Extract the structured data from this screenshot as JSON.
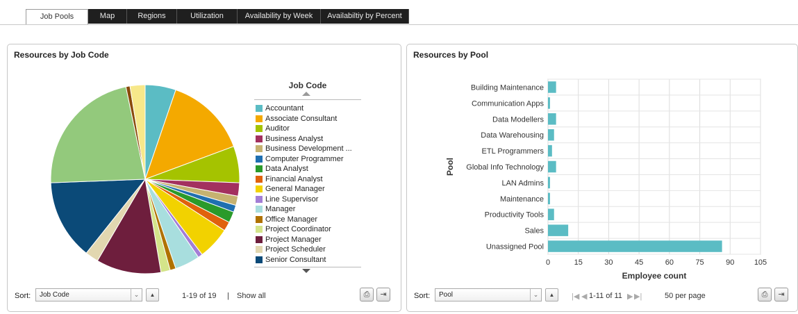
{
  "tabs": [
    {
      "label": "Job Pools",
      "active": true
    },
    {
      "label": "Map",
      "active": false
    },
    {
      "label": "Regions",
      "active": false
    },
    {
      "label": "Utilization",
      "active": false
    },
    {
      "label": "Availability by Week",
      "active": false
    },
    {
      "label": "Availabiltiy by Percent",
      "active": false
    }
  ],
  "left_panel": {
    "title": "Resources by Job Code",
    "legend_header": "Job Code",
    "legend": [
      {
        "label": "Accountant",
        "color": "#5bbcc4"
      },
      {
        "label": "Associate Consultant",
        "color": "#f4a900"
      },
      {
        "label": "Auditor",
        "color": "#a5c300"
      },
      {
        "label": "Business Analyst",
        "color": "#a3305f"
      },
      {
        "label": "Business Development ...",
        "color": "#c6b270"
      },
      {
        "label": "Computer Programmer",
        "color": "#1f6fb0"
      },
      {
        "label": "Data Analyst",
        "color": "#2a9a2a"
      },
      {
        "label": "Financial Analyst",
        "color": "#e0620c"
      },
      {
        "label": "General Manager",
        "color": "#f2d200"
      },
      {
        "label": "Line Supervisor",
        "color": "#a37ed6"
      },
      {
        "label": "Manager",
        "color": "#a8dede"
      },
      {
        "label": "Office Manager",
        "color": "#b07200"
      },
      {
        "label": "Project Coordinator",
        "color": "#d4e48a"
      },
      {
        "label": "Project Manager",
        "color": "#6e1e3d"
      },
      {
        "label": "Project Scheduler",
        "color": "#e2d7b0"
      },
      {
        "label": "Senior Consultant",
        "color": "#0b4a78"
      }
    ],
    "pie": {
      "slices": [
        {
          "name": "Accountant",
          "value": 5.3,
          "color": "#5bbcc4"
        },
        {
          "name": "Associate Consultant",
          "value": 14.2,
          "color": "#f4a900"
        },
        {
          "name": "Auditor",
          "value": 6.3,
          "color": "#a5c300"
        },
        {
          "name": "Business Analyst",
          "value": 2.3,
          "color": "#a3305f"
        },
        {
          "name": "Business Development ...",
          "value": 1.6,
          "color": "#c6b270"
        },
        {
          "name": "Computer Programmer",
          "value": 1.2,
          "color": "#1f6fb0"
        },
        {
          "name": "Data Analyst",
          "value": 1.9,
          "color": "#2a9a2a"
        },
        {
          "name": "Financial Analyst",
          "value": 1.6,
          "color": "#e0620c"
        },
        {
          "name": "General Manager",
          "value": 5.6,
          "color": "#f2d200"
        },
        {
          "name": "Line Supervisor",
          "value": 0.8,
          "color": "#a37ed6"
        },
        {
          "name": "Manager",
          "value": 4.3,
          "color": "#a8dede"
        },
        {
          "name": "Office Manager",
          "value": 1.0,
          "color": "#b07200"
        },
        {
          "name": "Project Coordinator",
          "value": 1.6,
          "color": "#d4e48a"
        },
        {
          "name": "Project Manager",
          "value": 11.2,
          "color": "#6e1e3d"
        },
        {
          "name": "Project Scheduler",
          "value": 2.3,
          "color": "#e2d7b0"
        },
        {
          "name": "Senior Consultant",
          "value": 13.8,
          "color": "#0b4a78"
        },
        {
          "name": "(unlisted)",
          "value": 22.5,
          "color": "#93c97c"
        },
        {
          "name": "(unlisted)",
          "value": 0.7,
          "color": "#8a4a0a"
        },
        {
          "name": "(unlisted)",
          "value": 2.6,
          "color": "#f7e88a"
        }
      ]
    },
    "footer": {
      "sort_label": "Sort:",
      "sort_value": "Job Code",
      "range": "1-19 of 19",
      "separator": "|",
      "show_all": "Show all"
    }
  },
  "right_panel": {
    "title": "Resources by Pool",
    "footer": {
      "sort_label": "Sort:",
      "sort_value": "Pool",
      "range": "1-11 of 11",
      "per_page": "50 per page"
    }
  },
  "chart_data": {
    "type": "bar",
    "orientation": "horizontal",
    "title": "Resources by Pool",
    "xlabel": "Employee count",
    "ylabel": "Pool",
    "categories": [
      "Building Maintenance",
      "Communication Apps",
      "Data Modellers",
      "Data Warehousing",
      "ETL Programmers",
      "Global Info Technology",
      "LAN Admins",
      "Maintenance",
      "Productivity Tools",
      "Sales",
      "Unassigned Pool"
    ],
    "values": [
      4,
      1,
      4,
      3,
      2,
      4,
      1,
      1,
      3,
      10,
      86
    ],
    "xlim": [
      0,
      105
    ],
    "xticks": [
      0,
      15,
      30,
      45,
      60,
      75,
      90,
      105
    ],
    "color": "#5bbcc4",
    "grid": true
  }
}
